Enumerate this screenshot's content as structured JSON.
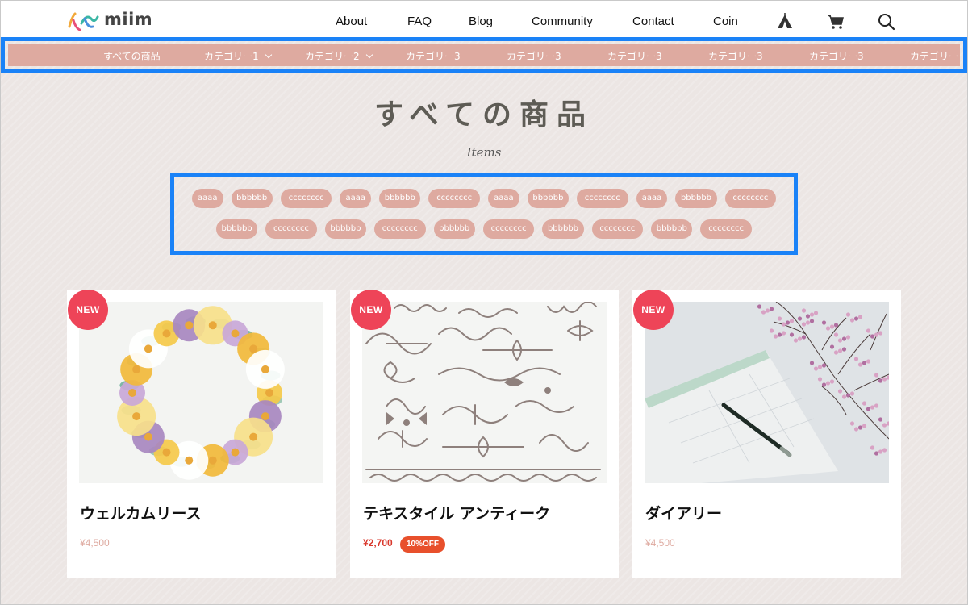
{
  "header": {
    "logo_text": "miim",
    "nav": [
      {
        "label": "About"
      },
      {
        "label": "FAQ"
      },
      {
        "label": "Blog"
      },
      {
        "label": "Community"
      },
      {
        "label": "Contact"
      },
      {
        "label": "Coin"
      }
    ],
    "icons": [
      "tent-icon",
      "cart-icon",
      "search-icon"
    ]
  },
  "category_bar": {
    "items": [
      {
        "label": "すべての商品",
        "dropdown": false
      },
      {
        "label": "カテゴリー1",
        "dropdown": true
      },
      {
        "label": "カテゴリー2",
        "dropdown": true
      },
      {
        "label": "カテゴリー3",
        "dropdown": false
      },
      {
        "label": "カテゴリー3",
        "dropdown": false
      },
      {
        "label": "カテゴリー3",
        "dropdown": false
      },
      {
        "label": "カテゴリー3",
        "dropdown": false
      },
      {
        "label": "カテゴリー3",
        "dropdown": false
      },
      {
        "label": "カテゴリー",
        "dropdown": false
      }
    ],
    "background_color": "#deaaa0"
  },
  "page": {
    "title": "すべての商品",
    "subtitle": "Items"
  },
  "tags": {
    "row1": [
      "aaaa",
      "bbbbbb",
      "cccccccc",
      "aaaa",
      "bbbbbb",
      "cccccccc",
      "aaaa",
      "bbbbbb",
      "cccccccc",
      "aaaa",
      "bbbbbb",
      "cccccccc"
    ],
    "row2": [
      "bbbbbb",
      "cccccccc",
      "bbbbbb",
      "cccccccc",
      "bbbbbb",
      "cccccccc",
      "bbbbbb",
      "cccccccc",
      "bbbbbb",
      "cccccccc"
    ]
  },
  "products": [
    {
      "badge": "NEW",
      "title": "ウェルカムリース",
      "price": "¥4,500",
      "sale": false,
      "image": "flower-wreath-illustration"
    },
    {
      "badge": "NEW",
      "title": "テキスタイル アンティーク",
      "price": "¥2,700",
      "sale": true,
      "discount_label": "10%OFF",
      "image": "antique-ornament-pattern"
    },
    {
      "badge": "NEW",
      "title": "ダイアリー",
      "price": "¥4,500",
      "sale": false,
      "image": "diary-and-flowers-photo"
    }
  ],
  "colors": {
    "accent_pink": "#deaaa0",
    "highlight_blue": "#1a82f7",
    "new_badge": "#ee4458",
    "discount_badge": "#e8502c"
  }
}
